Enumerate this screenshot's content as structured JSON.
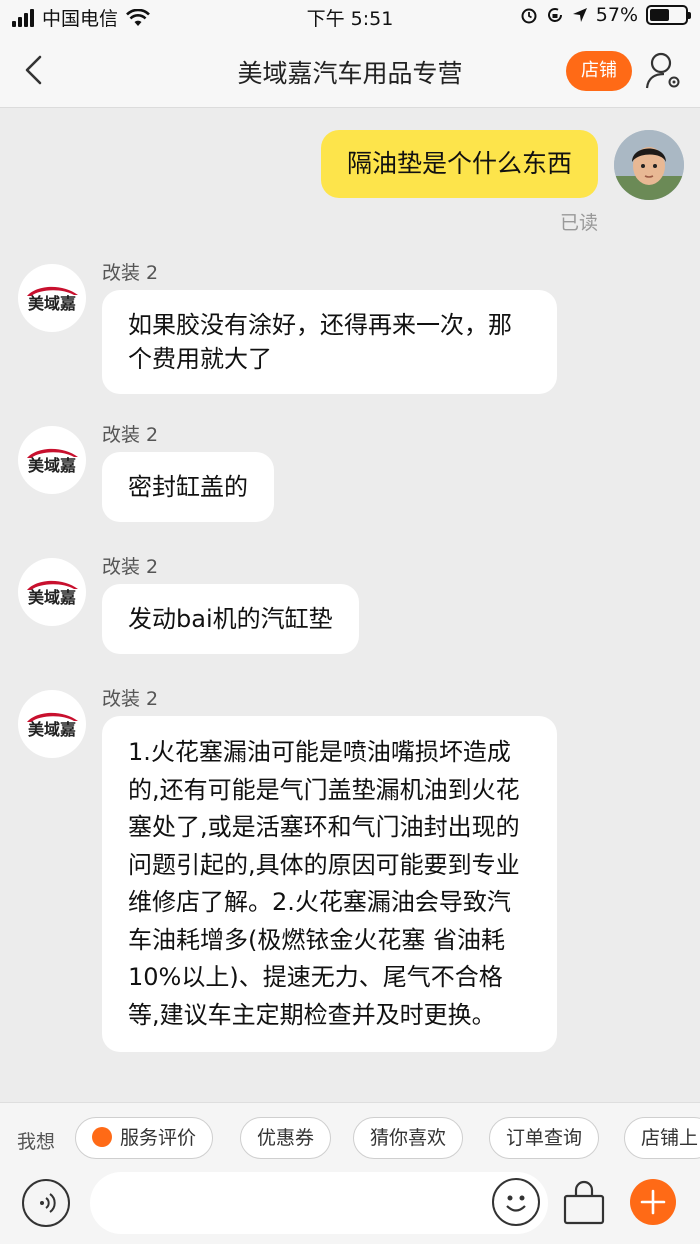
{
  "status_bar": {
    "carrier": "中国电信",
    "time": "下午 5:51",
    "battery": "57%",
    "battery_level": 0.57
  },
  "header": {
    "title": "美域嘉汽车用品专营",
    "shop_button": "店铺"
  },
  "shop": {
    "logo_text": "美域嘉"
  },
  "messages": [
    {
      "text": "隔油垫是个什么东西",
      "status": "已读"
    },
    {
      "sender": "改装 2",
      "text": "如果胶没有涂好，还得再来一次，那个费用就大了"
    },
    {
      "sender": "改装 2",
      "text": "密封缸盖的"
    },
    {
      "sender": "改装 2",
      "text": "发动bai机的汽缸垫"
    },
    {
      "sender": "改装 2",
      "text": "1.火花塞漏油可能是喷油嘴损坏造成的,还有可能是气门盖垫漏机油到火花塞处了,或是活塞环和气门油封出现的问题引起的,具体的原因可能要到专业维修店了解。2.火花塞漏油会导致汽车油耗增多(极燃铱金火花塞 省油耗10%以上)、提速无力、尾气不合格等,建议车主定期检查并及时更换。"
    }
  ],
  "quick_replies": {
    "lead": "我想",
    "items": [
      "服务评价",
      "优惠券",
      "猜你喜欢",
      "订单查询",
      "店铺上"
    ]
  },
  "colors": {
    "accent": "#ff6a16",
    "my_bubble": "#fde44b",
    "logo_red": "#c8102e"
  }
}
